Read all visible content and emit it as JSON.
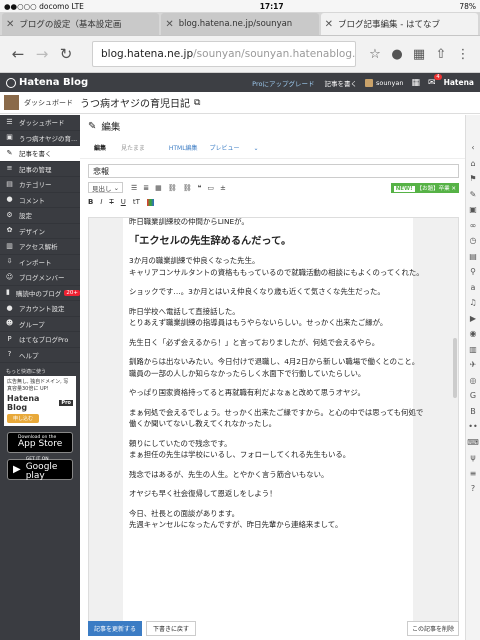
{
  "status": {
    "carrier": "●●○○○ docomo  LTE",
    "time": "17:17",
    "battery": "78%"
  },
  "tabs": [
    {
      "title": "ブログの設定（基本設定画"
    },
    {
      "title": "blog.hatena.ne.jp/sounyan"
    },
    {
      "title": "ブログ記事編集 - はてなブ"
    }
  ],
  "address": {
    "host": "blog.hatena.ne.jp",
    "path": "/sounyan/sounyan.hatenablog.com/edit"
  },
  "hatenabar": {
    "logo": "Hatena Blog",
    "pro": "Proにアップグレード",
    "write": "記事を書く",
    "user": "sounyan",
    "notif": "4",
    "brand": "Hatena"
  },
  "sub": {
    "dashboard": "ダッシュボード",
    "blogname": "うつ病オヤジの育児日記"
  },
  "sidebar": {
    "items": [
      {
        "icon": "☰",
        "label": "ダッシュボード"
      },
      {
        "icon": "▣",
        "label": "うつ病オヤジの育..."
      },
      {
        "icon": "✎",
        "label": "記事を書く"
      },
      {
        "icon": "≡",
        "label": "記事の管理"
      },
      {
        "icon": "▤",
        "label": "カテゴリー"
      },
      {
        "icon": "●",
        "label": "コメント"
      },
      {
        "icon": "⚙",
        "label": "設定"
      },
      {
        "icon": "✿",
        "label": "デザイン"
      },
      {
        "icon": "▥",
        "label": "アクセス解析"
      },
      {
        "icon": "⇩",
        "label": "インポート"
      },
      {
        "icon": "☺",
        "label": "ブログメンバー"
      },
      {
        "icon": "▮",
        "label": "購読中のブログ",
        "badge": "20+"
      },
      {
        "icon": "●",
        "label": "アカウント設定"
      },
      {
        "icon": "☻",
        "label": "グループ"
      },
      {
        "icon": "P",
        "label": "はてなブログPro"
      },
      {
        "icon": "?",
        "label": "ヘルプ"
      }
    ],
    "promo": {
      "title": "もっと快適に使う",
      "body1": "広告無し, 独自ドメイン, 写",
      "body2": "真容量30倍に UP!",
      "brand": "Hatena Blog",
      "tag": "Pro",
      "button": "申し込む"
    },
    "appstore": {
      "small": "Download on the",
      "big": "App Store"
    },
    "googleplay": {
      "small": "GET IT ON",
      "big": "Google play"
    }
  },
  "editor": {
    "header": "編集",
    "mode_current": "編集",
    "mode_sub": "見たまま",
    "mode_html": "HTML編集",
    "mode_preview": "プレビュー",
    "title": "悲報",
    "heading_select": "見出し",
    "new_tag": "NEW!",
    "new_text": "【お題】卒業",
    "bottom_publish": "記事を更新する",
    "bottom_draft": "下書きに戻す",
    "bottom_delete": "この記事を削除"
  },
  "body": {
    "p0": "昨日職業訓練校の仲間からLINEが。",
    "h": "「エクセルの先生辞めるんだって。",
    "p1a": "3か月の職業訓練で仲良くなった先生。",
    "p1b": "キャリアコンサルタントの資格ももっているので就職活動の相談にもよくのってくれた。",
    "p2": "ショックです…。3か月とはいえ仲良くなり歳も近くて気さくな先生だった。",
    "p3a": "昨日学校へ電話して直接話した。",
    "p3b": "とりあえず職業訓練の指導員はもうやらないらしい。せっかく出来たご縁が。",
    "p4": "先生日く「必ず会えるから！」と言っておりましたが、何処で会えるやら。",
    "p5a": "釧路からは出ないみたい。今日付けで退職し、4月2日から新しい職場で働くとのこと。",
    "p5b": "職員の一部の人しか知らなかったらしく水面下で行動していたらしい。",
    "p6": "やっぱり国家資格持ってると再就職有利だよなぁと改めて思うオヤジ。",
    "p7a": "まぁ何処で会えるでしょう。せっかく出来たご縁ですから。と心の中では思っても何処で",
    "p7b": "働くか聞いてないし教えてくれなかったし。",
    "p8a": "頼りにしていたので残念です。",
    "p8b": "まぁ担任の先生は学校にいるし、フォローしてくれる先生もいる。",
    "p9": "残念ではあるが、先生の人生。とやかく言う筋合いもない。",
    "p10": "オヤジも早く社会復帰して恩返しをしよう！",
    "p11a": "今日、社長との面談があります。",
    "p11b": "先週キャンセルになったんですが、昨日先輩から連絡来まして。"
  }
}
